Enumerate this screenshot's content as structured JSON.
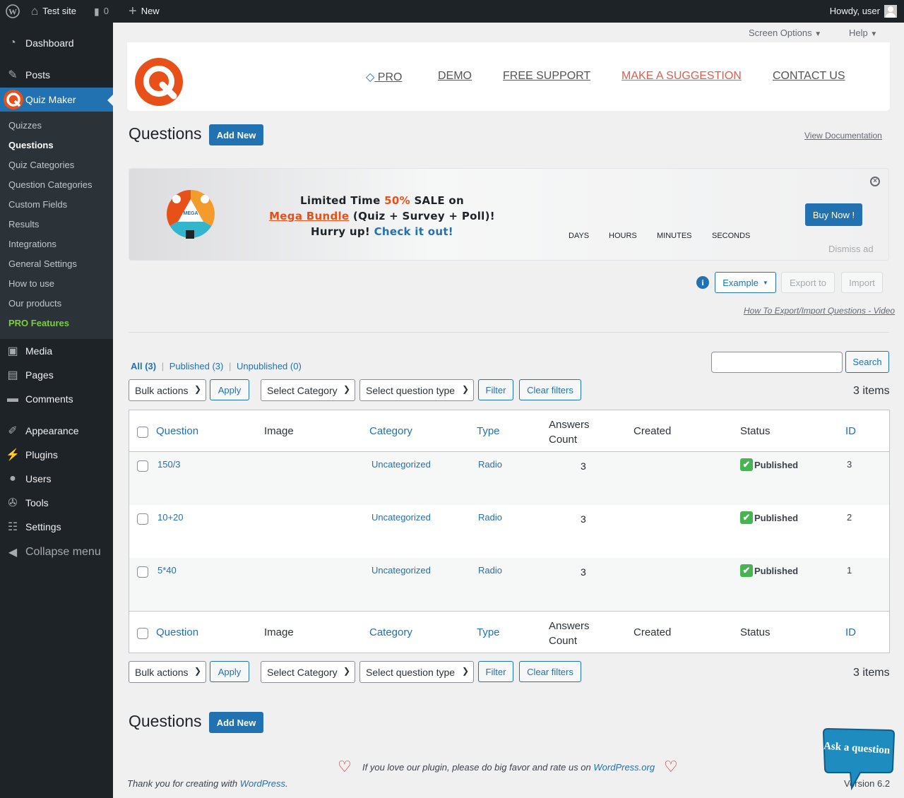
{
  "adminbar": {
    "site": "Test site",
    "comments": "0",
    "new": "New",
    "howdy": "Howdy, user"
  },
  "sidebar": {
    "items": [
      {
        "label": "Dashboard",
        "icon": "dashboard-icon"
      },
      {
        "label": "Posts",
        "icon": "pin-icon"
      },
      {
        "label": "Quiz Maker",
        "icon": "quiz-maker-logo-icon"
      },
      {
        "label": "Media",
        "icon": "media-icon"
      },
      {
        "label": "Pages",
        "icon": "pages-icon"
      },
      {
        "label": "Comments",
        "icon": "comment-icon"
      },
      {
        "label": "Appearance",
        "icon": "brush-icon"
      },
      {
        "label": "Plugins",
        "icon": "plugin-icon"
      },
      {
        "label": "Users",
        "icon": "user-icon"
      },
      {
        "label": "Tools",
        "icon": "wrench-icon"
      },
      {
        "label": "Settings",
        "icon": "settings-icon"
      },
      {
        "label": "Collapse menu",
        "icon": "collapse-icon"
      }
    ],
    "submenu": [
      "Quizzes",
      "Questions",
      "Quiz Categories",
      "Question Categories",
      "Custom Fields",
      "Results",
      "Integrations",
      "General Settings",
      "How to use",
      "Our products",
      "PRO Features"
    ]
  },
  "screen_options": "Screen Options",
  "help": "Help",
  "topnav": {
    "pro": "PRO",
    "demo": "DEMO",
    "support": "FREE SUPPORT",
    "suggestion": "MAKE A SUGGESTION",
    "contact": "CONTACT US"
  },
  "page": {
    "title": "Questions",
    "add_new": "Add New",
    "view_docs": "View Documentation"
  },
  "banner": {
    "line1_a": "Limited Time ",
    "line1_pct": "50%",
    "line1_b": " SALE on",
    "bundle": "Mega Bundle",
    "line2_b": " (Quiz + Survey + Poll)!",
    "line3_a": "Hurry up! ",
    "check": "Check it out!",
    "days": "DAYS",
    "hours": "HOURS",
    "minutes": "MINUTES",
    "seconds": "SECONDS",
    "buy": "Buy Now !",
    "dismiss": "Dismiss ad",
    "logo_text": "MEGA"
  },
  "tools": {
    "example": "Example",
    "export": "Export to",
    "import": "Import",
    "video_link": "How To Export/Import Questions - Video"
  },
  "filters": {
    "all": "All (3)",
    "published": "Published (3)",
    "unpublished": "Unpublished (0)",
    "search": "Search",
    "bulk": "Bulk actions",
    "apply": "Apply",
    "category": "Select Category",
    "qtype": "Select question type",
    "filter": "Filter",
    "clear": "Clear filters",
    "items": "3 items"
  },
  "table": {
    "headers": {
      "question": "Question",
      "image": "Image",
      "category": "Category",
      "type": "Type",
      "answers_1": "Answers",
      "answers_2": "Count",
      "created": "Created",
      "status": "Status",
      "id": "ID"
    },
    "rows": [
      {
        "question": "150/3",
        "category": "Uncategorized",
        "type": "Radio",
        "answers": "3",
        "status": "Published",
        "id": "3"
      },
      {
        "question": "10+20",
        "category": "Uncategorized",
        "type": "Radio",
        "answers": "3",
        "status": "Published",
        "id": "2"
      },
      {
        "question": "5*40",
        "category": "Uncategorized",
        "type": "Radio",
        "answers": "3",
        "status": "Published",
        "id": "1"
      }
    ]
  },
  "footer": {
    "love_a": "If you love our plugin, please do big favor and rate us on ",
    "love_link": "WordPress.org",
    "thanks_a": "Thank you for creating with ",
    "thanks_link": "WordPress",
    "thanks_b": ".",
    "version": "Version 6.2",
    "ask": "Ask a question"
  },
  "colors": {
    "accent": "#2271b1",
    "brand_orange": "#e8501a",
    "suggestion": "#e05b4b",
    "pro_green": "#7ad03a"
  }
}
